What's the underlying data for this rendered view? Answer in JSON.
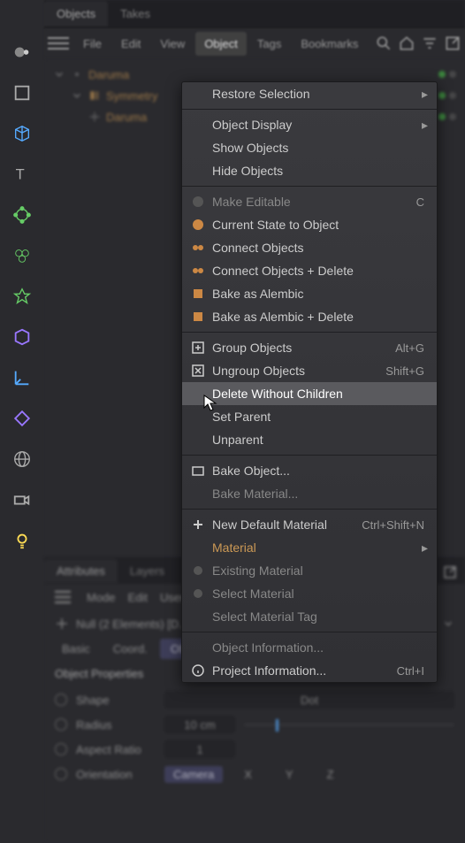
{
  "tabs": {
    "objects": "Objects",
    "takes": "Takes"
  },
  "menubar": {
    "file": "File",
    "edit": "Edit",
    "view": "View",
    "object": "Object",
    "tags": "Tags",
    "bookmarks": "Bookmarks"
  },
  "tree": {
    "items": [
      {
        "name": "Daruma"
      },
      {
        "name": "Symmetry"
      },
      {
        "name": "Daruma"
      }
    ]
  },
  "dropdown": {
    "restore_selection": "Restore Selection",
    "object_display": "Object Display",
    "show_objects": "Show Objects",
    "hide_objects": "Hide Objects",
    "make_editable": "Make Editable",
    "make_editable_key": "C",
    "current_state": "Current State to Object",
    "connect": "Connect Objects",
    "connect_delete": "Connect Objects + Delete",
    "bake_alembic": "Bake as Alembic",
    "bake_alembic_delete": "Bake as Alembic + Delete",
    "group": "Group Objects",
    "group_key": "Alt+G",
    "ungroup": "Ungroup Objects",
    "ungroup_key": "Shift+G",
    "delete_wo_children": "Delete Without Children",
    "set_parent": "Set Parent",
    "unparent": "Unparent",
    "bake_object": "Bake Object...",
    "bake_material": "Bake Material...",
    "new_default_mat": "New Default Material",
    "new_default_mat_key": "Ctrl+Shift+N",
    "material": "Material",
    "existing_material": "Existing Material",
    "select_material": "Select Material",
    "select_material_tag": "Select Material Tag",
    "object_info": "Object Information...",
    "project_info": "Project Information...",
    "project_info_key": "Ctrl+I"
  },
  "lower": {
    "tabs": {
      "attributes": "Attributes",
      "layers": "Layers"
    },
    "mode_row": {
      "mode": "Mode",
      "edit": "Edit",
      "user": "User"
    },
    "null_label": "Null (2 Elements) [D...",
    "sub_tabs": {
      "basic": "Basic",
      "coord": "Coord.",
      "object": "Object"
    },
    "props_title": "Object Properties",
    "props": {
      "shape": "Shape",
      "shape_val": "Dot",
      "radius": "Radius",
      "radius_val": "10 cm",
      "aspect": "Aspect Ratio",
      "aspect_val": "1",
      "orient": "Orientation",
      "orient_val": "Camera",
      "x": "X",
      "y": "Y",
      "z": "Z"
    }
  }
}
